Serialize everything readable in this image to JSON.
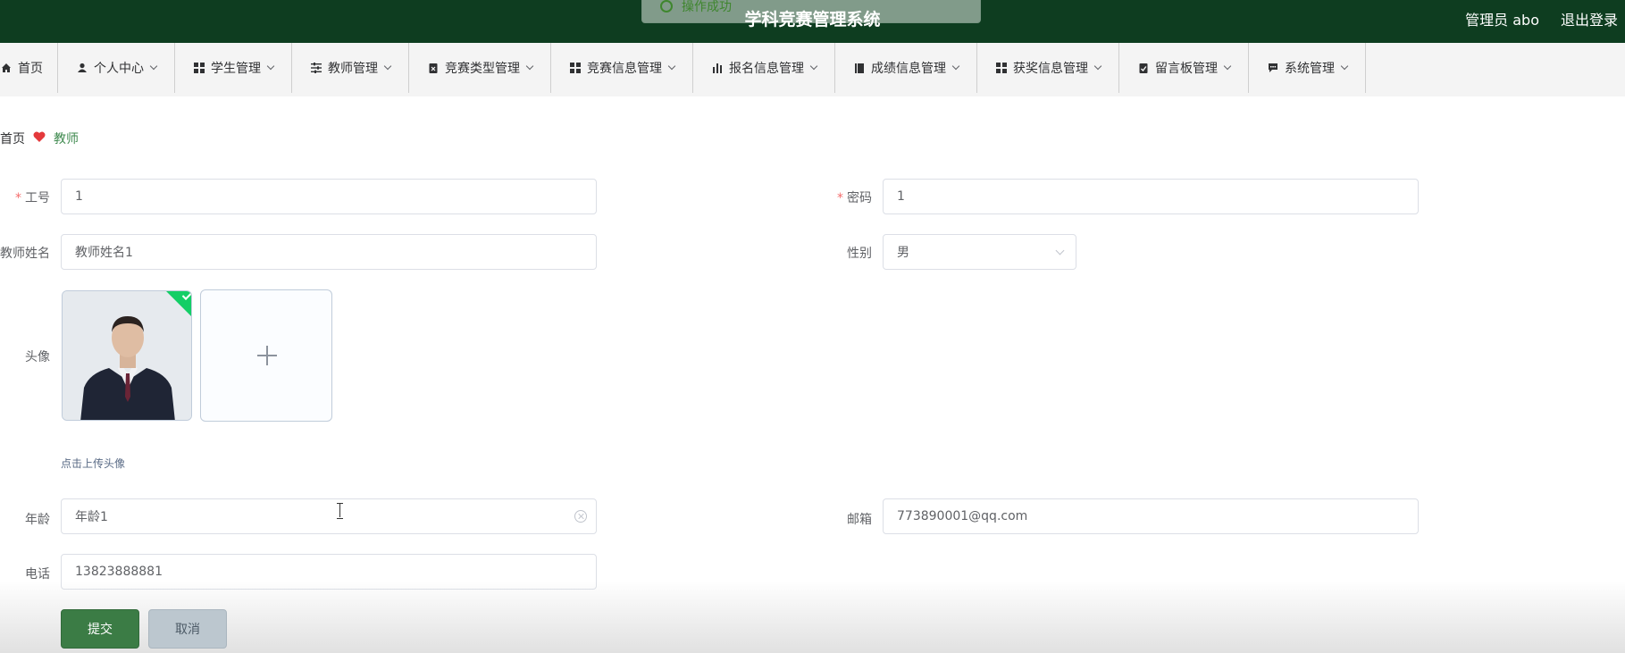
{
  "header": {
    "title": "学科竞赛管理系统",
    "user_label": "管理员 abo",
    "logout_label": "退出登录",
    "toast_text": "操作成功"
  },
  "menu": {
    "items": [
      {
        "label": "首页",
        "icon": "home-icon"
      },
      {
        "label": "个人中心",
        "icon": "user-icon"
      },
      {
        "label": "学生管理",
        "icon": "grid-icon"
      },
      {
        "label": "教师管理",
        "icon": "sliders-icon"
      },
      {
        "label": "竞赛类型管理",
        "icon": "clipboard-x-icon"
      },
      {
        "label": "竞赛信息管理",
        "icon": "grid-icon"
      },
      {
        "label": "报名信息管理",
        "icon": "bar-chart-icon"
      },
      {
        "label": "成绩信息管理",
        "icon": "book-icon"
      },
      {
        "label": "获奖信息管理",
        "icon": "grid-icon"
      },
      {
        "label": "留言板管理",
        "icon": "clipboard-check-icon"
      },
      {
        "label": "系统管理",
        "icon": "chat-icon"
      }
    ]
  },
  "breadcrumb": {
    "home": "首页",
    "current": "教师",
    "separator_color": "#e4393c"
  },
  "form": {
    "employee_id": {
      "label": "工号",
      "value": "1",
      "required": true
    },
    "password": {
      "label": "密码",
      "value": "1",
      "required": true
    },
    "teacher_name": {
      "label": "教师姓名",
      "value": "教师姓名1"
    },
    "gender": {
      "label": "性别",
      "value": "男"
    },
    "avatar": {
      "label": "头像",
      "tip": "点击上传头像"
    },
    "age": {
      "label": "年龄",
      "value": "年龄1"
    },
    "email": {
      "label": "邮箱",
      "value": "773890001@qq.com"
    },
    "phone": {
      "label": "电话",
      "value": "13823888881"
    }
  },
  "buttons": {
    "submit": "提交",
    "cancel": "取消"
  },
  "colors": {
    "header_bg": "#0e3d20",
    "accent": "#3b7c45",
    "success": "#13ce66"
  }
}
